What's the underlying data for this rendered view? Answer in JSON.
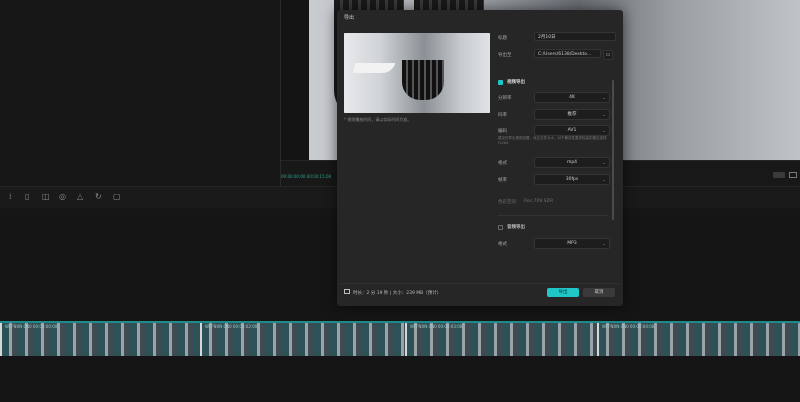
{
  "bg": {
    "preview_timestamp": "00:00:00:00  00:00:15:08",
    "timeline_labels": [
      "WFFNXN 0N0 00:00:00:00",
      "WFFNXN 0N0 00:00:02:00",
      "WFFNXN 0N0 00:00:03:00",
      "WFFNXN 0N0 00:00:04:00"
    ],
    "toolbar_icons": [
      "split-icon",
      "delete-icon",
      "crop-icon",
      "speed-icon",
      "mirror-icon",
      "rotate-icon",
      "freeze-icon"
    ]
  },
  "modal": {
    "title": "导出",
    "tip": "* 视频播放时间，请以实际时间为准。",
    "title_label": "标题",
    "title_value": "2月10日",
    "export_to_label": "导出至",
    "export_to_value": "C:/Users/6138/Deskto...",
    "video_section": "视频导出",
    "resolution_label": "分辨率",
    "resolution_value": "4K",
    "bitrate_label": "码率",
    "bitrate_value": "推荐",
    "codec_label": "编码",
    "codec_value": "AV1",
    "codec_note_1": "建议在导出视频设置，对比文件大小，对于兼容性要求较高的建议选择 H.264",
    "codec_note_2": "",
    "format_label": "格式",
    "format_value": "mp4",
    "framerate_label": "帧率",
    "framerate_value": "30fps",
    "color_label": "色彩空间",
    "color_value": "Rec.709 SDR",
    "audio_section": "音频导出",
    "audio_format_label": "格式",
    "audio_format_value": "MP3",
    "footer_info": "时长：2 分 19 秒 | 大小：239 MB（预计）",
    "export_button": "导出",
    "cancel_button": "取消",
    "accent_color": "#1fc7c9"
  }
}
